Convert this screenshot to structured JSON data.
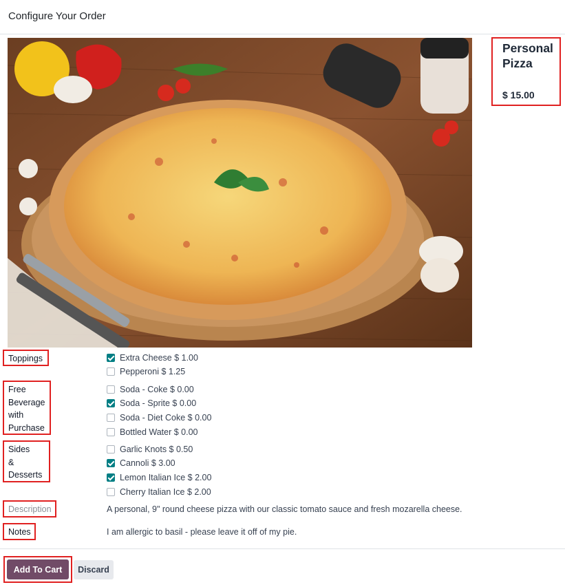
{
  "dialog": {
    "title": "Configure Your Order"
  },
  "product": {
    "name": "Personal Pizza",
    "price": "$ 15.00"
  },
  "attributes": [
    {
      "label": "Toppings",
      "options": [
        {
          "label": "Extra Cheese $ 1.00",
          "checked": true
        },
        {
          "label": "Pepperoni $ 1.25",
          "checked": false
        }
      ]
    },
    {
      "label": "Free Beverage with Purchase",
      "options": [
        {
          "label": "Soda - Coke $ 0.00",
          "checked": false
        },
        {
          "label": "Soda - Sprite $ 0.00",
          "checked": true
        },
        {
          "label": "Soda - Diet Coke $ 0.00",
          "checked": false
        },
        {
          "label": "Bottled Water $ 0.00",
          "checked": false
        }
      ]
    },
    {
      "label": "Sides & Desserts",
      "options": [
        {
          "label": "Garlic Knots $ 0.50",
          "checked": false
        },
        {
          "label": "Cannoli $ 3.00",
          "checked": true
        },
        {
          "label": "Lemon Italian Ice $ 2.00",
          "checked": true
        },
        {
          "label": "Cherry Italian Ice $ 2.00",
          "checked": false
        }
      ]
    }
  ],
  "description": {
    "label": "Description",
    "text": "A personal, 9\" round cheese pizza with our classic tomato sauce and fresh mozarella cheese."
  },
  "notes": {
    "label": "Notes",
    "text": "I am allergic to basil - please leave it off of my pie."
  },
  "footer": {
    "add_label": "Add To Cart",
    "discard_label": "Discard"
  },
  "colors": {
    "primary": "#714b67",
    "checkbox": "#017e84",
    "highlight": "#e02020"
  }
}
